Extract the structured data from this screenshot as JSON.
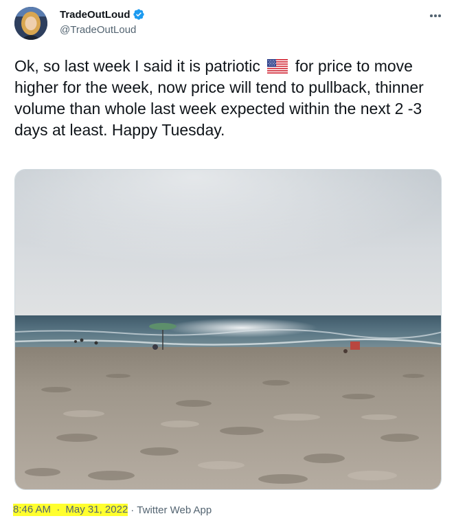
{
  "author": {
    "display_name": "TradeOutLoud",
    "handle": "@TradeOutLoud",
    "verified": true
  },
  "tweet": {
    "text_before_flag": "Ok, so last week I said it is patriotic",
    "flag_emoji": "us-flag-icon",
    "text_after_flag": "for price to move higher for the week, now price will tend to pullback, thinner volume than whole last week expected within the next 2 -3 days at least. Happy Tuesday."
  },
  "media": {
    "type": "photo",
    "subject": "beach"
  },
  "meta": {
    "time": "8:46 AM",
    "separator": "·",
    "date": "May 31, 2022",
    "source": "Twitter Web App"
  },
  "colors": {
    "text": "#0f1419",
    "secondary": "#536471",
    "verified_blue": "#1d9bf0",
    "highlight": "#ffff2e"
  }
}
